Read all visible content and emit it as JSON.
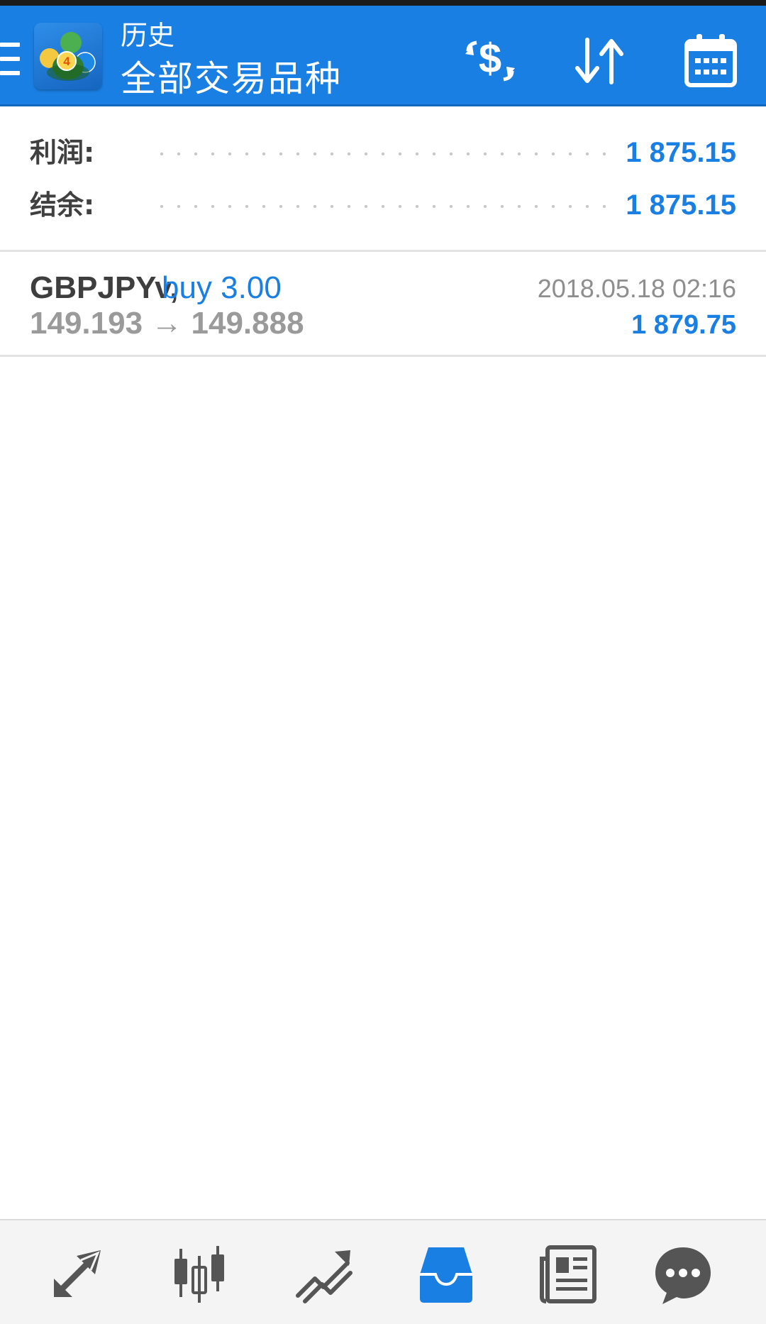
{
  "header": {
    "subtitle": "历史",
    "title": "全部交易品种",
    "actions": [
      {
        "name": "currency-exchange-icon"
      },
      {
        "name": "sort-icon"
      },
      {
        "name": "calendar-icon"
      }
    ]
  },
  "summary": {
    "profit_label": "利润:",
    "profit_value": "1 875.15",
    "balance_label": "结余:",
    "balance_value": "1 875.15"
  },
  "trades": [
    {
      "symbol": "GBPJPYv,",
      "type": "buy 3.00",
      "prices": "149.193 → 149.888",
      "time": "2018.05.18 02:16",
      "profit": "1 879.75"
    }
  ],
  "bottom_nav": [
    {
      "icon": "quotes-icon",
      "active": false
    },
    {
      "icon": "chart-icon",
      "active": false
    },
    {
      "icon": "trade-icon",
      "active": false
    },
    {
      "icon": "history-icon",
      "active": true
    },
    {
      "icon": "news-icon",
      "active": false
    },
    {
      "icon": "messages-icon",
      "active": false
    }
  ],
  "colors": {
    "brand_blue": "#1a7fe3",
    "nav_icon_gray": "#555555",
    "text_dark": "#3e3e3e",
    "text_gray": "#9a9a9a"
  }
}
